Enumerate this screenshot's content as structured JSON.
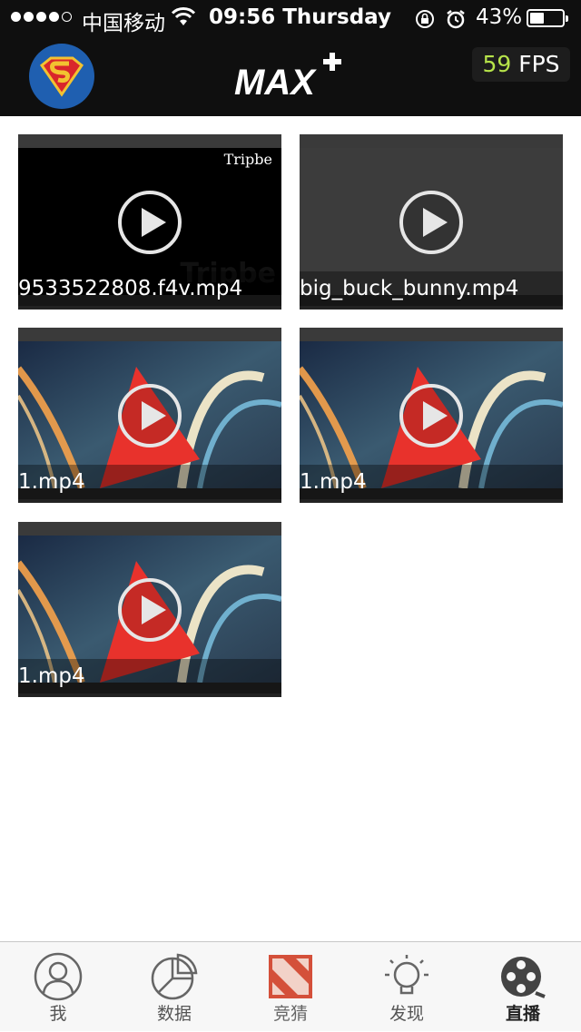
{
  "status_bar": {
    "carrier": "中国移动",
    "time": "09:56 Thursday",
    "battery_percent": "43%",
    "battery_level": 0.43
  },
  "nav": {
    "avatar": "superman-icon",
    "logo_text": "MAX",
    "fps_value": "59",
    "fps_label": "FPS"
  },
  "videos": [
    {
      "name": "9533522808.f4v.mp4",
      "thumb": "tripbe",
      "watermark": "Tripbe"
    },
    {
      "name": "big_buck_bunny.mp4",
      "thumb": "gray"
    },
    {
      "name": "1.mp4",
      "thumb": "abstract"
    },
    {
      "name": "1.mp4",
      "thumb": "abstract"
    },
    {
      "name": "1.mp4",
      "thumb": "abstract"
    }
  ],
  "tabs": [
    {
      "label": "我",
      "icon": "person-icon"
    },
    {
      "label": "数据",
      "icon": "pie-chart-icon"
    },
    {
      "label": "竞猜",
      "icon": "dota-icon"
    },
    {
      "label": "发现",
      "icon": "lightbulb-icon"
    },
    {
      "label": "直播",
      "icon": "film-reel-icon"
    }
  ],
  "colors": {
    "accent": "#b6e34a",
    "bar": "#0f0f0f",
    "dota": "#d4503a"
  }
}
